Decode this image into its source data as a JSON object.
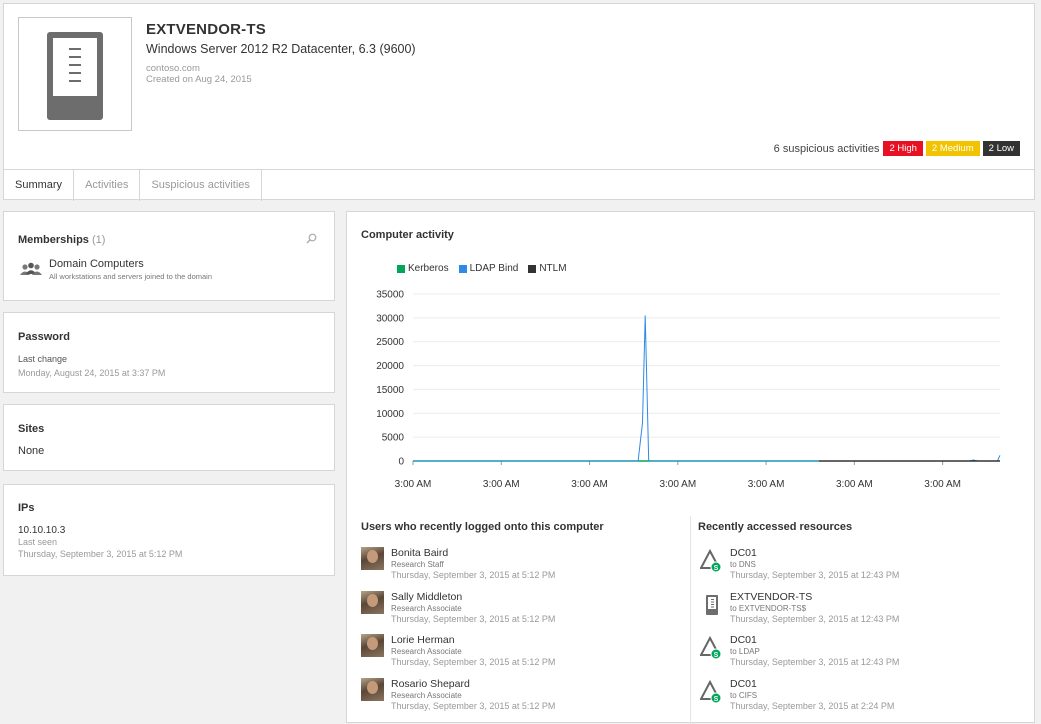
{
  "computer": {
    "name": "EXTVENDOR-TS",
    "os": "Windows Server 2012 R2 Datacenter, 6.3 (9600)",
    "domain": "contoso.com",
    "created": "Created on Aug 24, 2015"
  },
  "suspicious": {
    "summary": "6 suspicious activities",
    "high": "2 High",
    "medium": "2 Medium",
    "low": "2 Low",
    "colors": {
      "high": "#e81123",
      "medium": "#f2c400",
      "low": "#333333"
    }
  },
  "tabs": [
    "Summary",
    "Activities",
    "Suspicious activities"
  ],
  "memberships": {
    "title": "Memberships",
    "count": "(1)",
    "group_name": "Domain Computers",
    "group_desc": "All workstations and servers joined to the domain"
  },
  "password": {
    "title": "Password",
    "label": "Last change",
    "value": "Monday, August 24, 2015 at 3:37 PM"
  },
  "sites": {
    "title": "Sites",
    "value": "None"
  },
  "ips": {
    "title": "IPs",
    "ip": "10.10.10.3",
    "label": "Last seen",
    "value": "Thursday, September 3, 2015 at 5:12 PM"
  },
  "activity": {
    "title": "Computer activity"
  },
  "chart_data": {
    "type": "line",
    "title": "Computer activity",
    "xlabel": "",
    "ylabel": "",
    "x_tick_labels": [
      "3:00 AM",
      "3:00 AM",
      "3:00 AM",
      "3:00 AM",
      "3:00 AM",
      "3:00 AM",
      "3:00 AM"
    ],
    "y_ticks": [
      0,
      5000,
      10000,
      15000,
      20000,
      25000,
      30000,
      35000
    ],
    "ylim": [
      0,
      35000
    ],
    "xlim": [
      0,
      6.65
    ],
    "grid": true,
    "legend_position": "top-left",
    "series": [
      {
        "name": "Kerberos",
        "color": "#00a65a",
        "x": [
          0,
          4.6
        ],
        "values": [
          0,
          0
        ]
      },
      {
        "name": "LDAP Bind",
        "color": "#2e8ae6",
        "x": [
          0,
          2.55,
          2.6,
          2.63,
          2.67,
          2.7,
          6.3,
          6.35,
          6.4,
          6.62,
          6.65
        ],
        "values": [
          0,
          0,
          8000,
          30500,
          50,
          0,
          0,
          200,
          0,
          0,
          1200
        ]
      },
      {
        "name": "NTLM",
        "color": "#333333",
        "x": [
          4.6,
          6.65
        ],
        "values": [
          0,
          0
        ]
      }
    ]
  },
  "users": {
    "title": "Users who recently logged onto this computer",
    "items": [
      {
        "name": "Bonita Baird",
        "role": "Research Staff",
        "time": "Thursday, September 3, 2015 at 5:12 PM"
      },
      {
        "name": "Sally Middleton",
        "role": "Research Associate",
        "time": "Thursday, September 3, 2015 at 5:12 PM"
      },
      {
        "name": "Lorie Herman",
        "role": "Research Associate",
        "time": "Thursday, September 3, 2015 at 5:12 PM"
      },
      {
        "name": "Rosario Shepard",
        "role": "Research Associate",
        "time": "Thursday, September 3, 2015 at 5:12 PM"
      }
    ]
  },
  "resources": {
    "title": "Recently accessed resources",
    "items": [
      {
        "name": "DC01",
        "target": "to DNS",
        "time": "Thursday, September 3, 2015 at 12:43 PM",
        "icon": "dc-icon"
      },
      {
        "name": "EXTVENDOR-TS",
        "target": "to EXTVENDOR-TS$",
        "time": "Thursday, September 3, 2015 at 12:43 PM",
        "icon": "computer-icon"
      },
      {
        "name": "DC01",
        "target": "to LDAP",
        "time": "Thursday, September 3, 2015 at 12:43 PM",
        "icon": "dc-icon"
      },
      {
        "name": "DC01",
        "target": "to CIFS",
        "time": "Thursday, September 3, 2015 at 2:24 PM",
        "icon": "dc-icon"
      }
    ]
  }
}
